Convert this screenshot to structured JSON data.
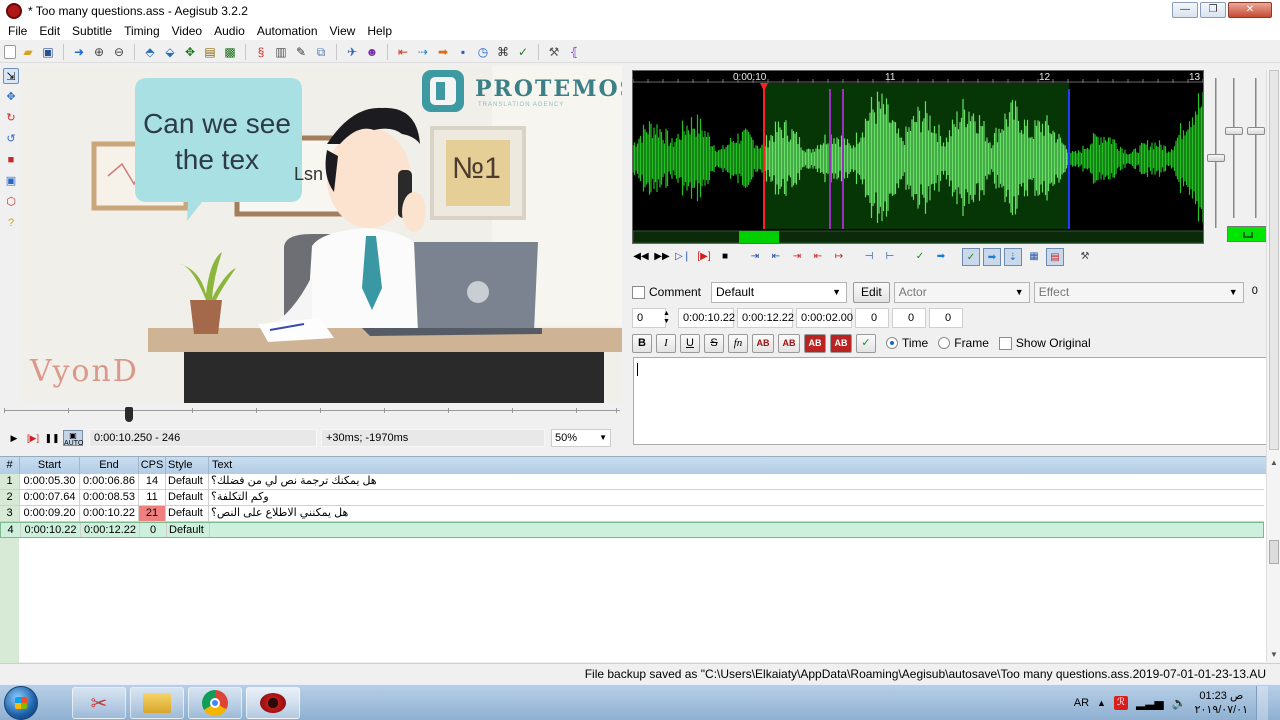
{
  "window": {
    "title": "* Too many questions.ass - Aegisub 3.2.2",
    "minimize": "—",
    "maximize": "❐",
    "close": "✕"
  },
  "menu": [
    "File",
    "Edit",
    "Subtitle",
    "Timing",
    "Video",
    "Audio",
    "Automation",
    "View",
    "Help"
  ],
  "video": {
    "bubble_text": "Can we see the tex",
    "sign_fragment": "Lsn",
    "logo": "PROTEMOS",
    "logo_sub": "TRANSLATION AGENCY",
    "poster": "№1",
    "watermark": "VyonD",
    "frame_time": "0:00:10.250 - 246",
    "offset": "+30ms; -1970ms",
    "zoom": "50%",
    "auto_label": "AUTO"
  },
  "audio": {
    "ruler_labels": [
      "0:00:10",
      "11",
      "12",
      "13"
    ],
    "colors": {
      "wave": "#22c022",
      "wave_selected": "#66e066",
      "selection_bg": "#063606",
      "start_marker": "#ff2020",
      "end_marker": "#1e3cff",
      "keyframe": "#9b30c0"
    }
  },
  "edit": {
    "comment_label": "Comment",
    "style": "Default",
    "edit_button": "Edit",
    "actor_placeholder": "Actor",
    "effect_placeholder": "Effect",
    "effect_value": "0",
    "layer": "0",
    "start_time": "0:00:10.22",
    "end_time": "0:00:12.22",
    "duration": "0:00:02.00",
    "margin_l": "0",
    "margin_r": "0",
    "margin_v": "0",
    "bold": "B",
    "italic": "I",
    "underline": "U",
    "strike": "S",
    "font": "fn",
    "color1": "AB",
    "color2": "AB",
    "color3": "AB",
    "color4": "AB",
    "time_label": "Time",
    "frame_label": "Frame",
    "show_original_label": "Show Original",
    "text": ""
  },
  "grid": {
    "headers": [
      "#",
      "Start",
      "End",
      "CPS",
      "Style",
      "Text"
    ],
    "rows": [
      {
        "num": "1",
        "start": "0:00:05.30",
        "end": "0:00:06.86",
        "cps": "14",
        "style": "Default",
        "text": "هل يمكنك ترجمة نص لي من فضلك؟",
        "cps_warn": false
      },
      {
        "num": "2",
        "start": "0:00:07.64",
        "end": "0:00:08.53",
        "cps": "11",
        "style": "Default",
        "text": "وكم التكلفة؟",
        "cps_warn": false
      },
      {
        "num": "3",
        "start": "0:00:09.20",
        "end": "0:00:10.22",
        "cps": "21",
        "style": "Default",
        "text": "هل يمكنني الاطلاع على النص؟",
        "cps_warn": true
      },
      {
        "num": "4",
        "start": "0:00:10.22",
        "end": "0:00:12.22",
        "cps": "0",
        "style": "Default",
        "text": "",
        "cps_warn": false
      }
    ]
  },
  "status": {
    "message": "File backup saved as \"C:\\Users\\Elkaiaty\\AppData\\Roaming\\Aegisub\\autosave\\Too many questions.ass.2019-07-01-01-23-13.AU"
  },
  "taskbar": {
    "lang": "AR",
    "time": "01:23 ص",
    "date": "٢٠١٩/٠٧/٠١"
  }
}
